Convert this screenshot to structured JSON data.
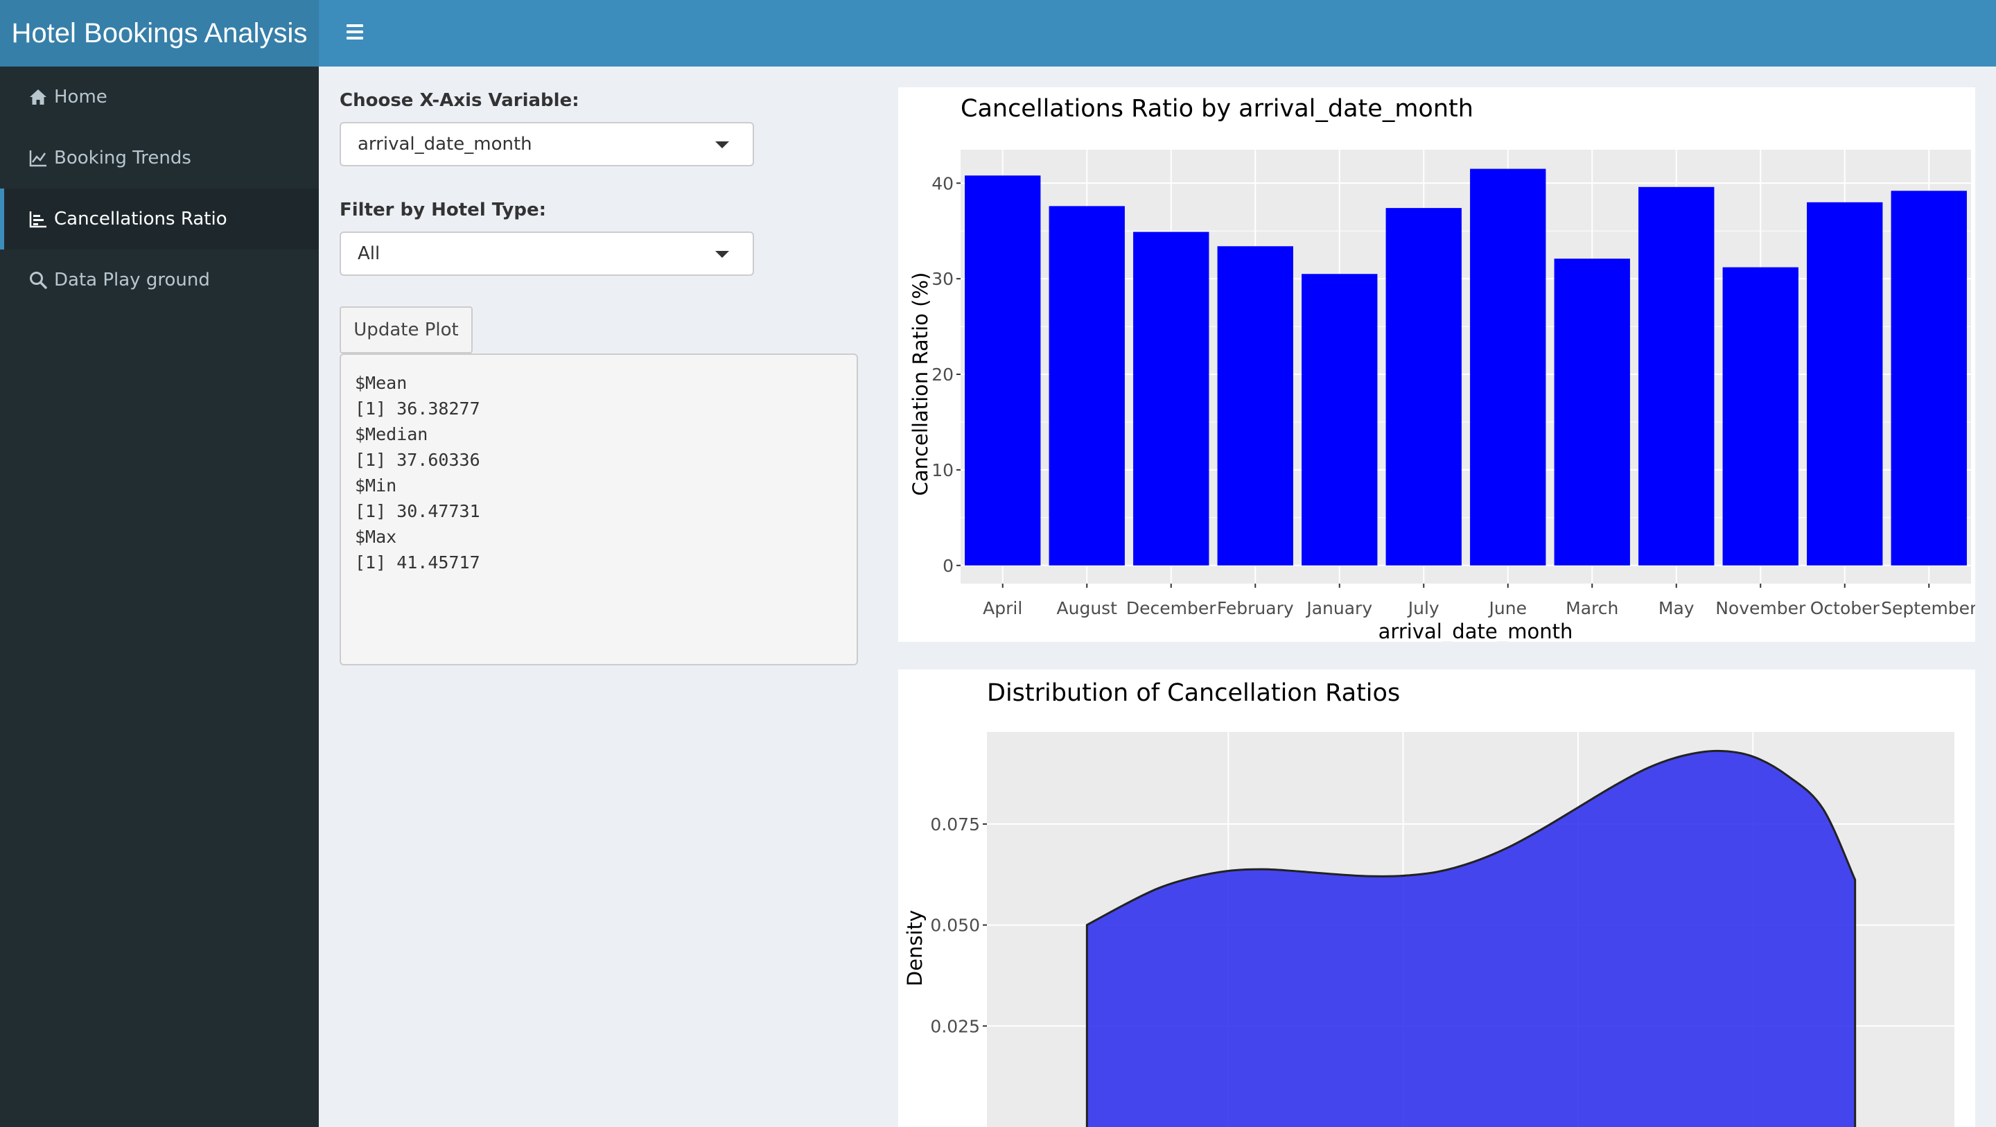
{
  "header": {
    "app_title": "Hotel Bookings Analysis",
    "menu_toggle_icon": "hamburger-icon"
  },
  "sidebar": {
    "items": [
      {
        "label": "Home",
        "icon": "home-icon"
      },
      {
        "label": "Booking Trends",
        "icon": "line-chart-icon"
      },
      {
        "label": "Cancellations Ratio",
        "icon": "bar-chart-icon",
        "active": true
      },
      {
        "label": "Data Play ground",
        "icon": "search-icon"
      }
    ]
  },
  "controls": {
    "x_axis_label": "Choose X-Axis Variable:",
    "x_axis_value": "arrival_date_month",
    "hotel_type_label": "Filter by Hotel Type:",
    "hotel_type_value": "All",
    "update_button": "Update Plot"
  },
  "stats_output": [
    {
      "name": "$Mean",
      "value": "[1] 36.38277"
    },
    {
      "name": "$Median",
      "value": "[1] 37.60336"
    },
    {
      "name": "$Min",
      "value": "[1] 30.47731"
    },
    {
      "name": "$Max",
      "value": "[1] 41.45717"
    }
  ],
  "chart_data": [
    {
      "type": "bar",
      "title": "Cancellations Ratio by arrival_date_month",
      "xlabel": "arrival_date_month",
      "ylabel": "Cancellation Ratio (%)",
      "categories": [
        "April",
        "August",
        "December",
        "February",
        "January",
        "July",
        "June",
        "March",
        "May",
        "November",
        "October",
        "September"
      ],
      "values": [
        40.8,
        37.6,
        34.9,
        33.4,
        30.5,
        37.4,
        41.5,
        32.1,
        39.6,
        31.2,
        38.0,
        39.2
      ],
      "ylim": [
        -1.9,
        43.5
      ],
      "yticks": [
        0,
        10,
        20,
        30,
        40
      ],
      "bar_color": "#0000ff",
      "grid": true
    },
    {
      "type": "area",
      "title": "Distribution of Cancellation Ratios",
      "ylabel": "Density",
      "x": [
        30.48,
        31.0,
        31.5,
        32.0,
        32.5,
        33.0,
        33.5,
        34.0,
        34.5,
        35.0,
        35.5,
        36.0,
        36.5,
        37.0,
        37.5,
        38.0,
        38.5,
        39.0,
        39.5,
        40.0,
        40.5,
        41.0,
        41.46
      ],
      "y": [
        0.05,
        0.0549,
        0.0591,
        0.0618,
        0.0634,
        0.0638,
        0.0633,
        0.0626,
        0.0621,
        0.0622,
        0.0632,
        0.0656,
        0.0692,
        0.0739,
        0.0791,
        0.0843,
        0.0889,
        0.0919,
        0.0931,
        0.0917,
        0.0869,
        0.0788,
        0.0612
      ],
      "yticks": [
        0.025,
        0.05,
        0.075
      ],
      "ytick_labels": [
        "0.025",
        "0.050",
        "0.075"
      ],
      "xlim": [
        29.05,
        42.88
      ],
      "ylim": [
        0,
        0.0978
      ],
      "fill_color": "#3333ee",
      "grid": true
    }
  ]
}
